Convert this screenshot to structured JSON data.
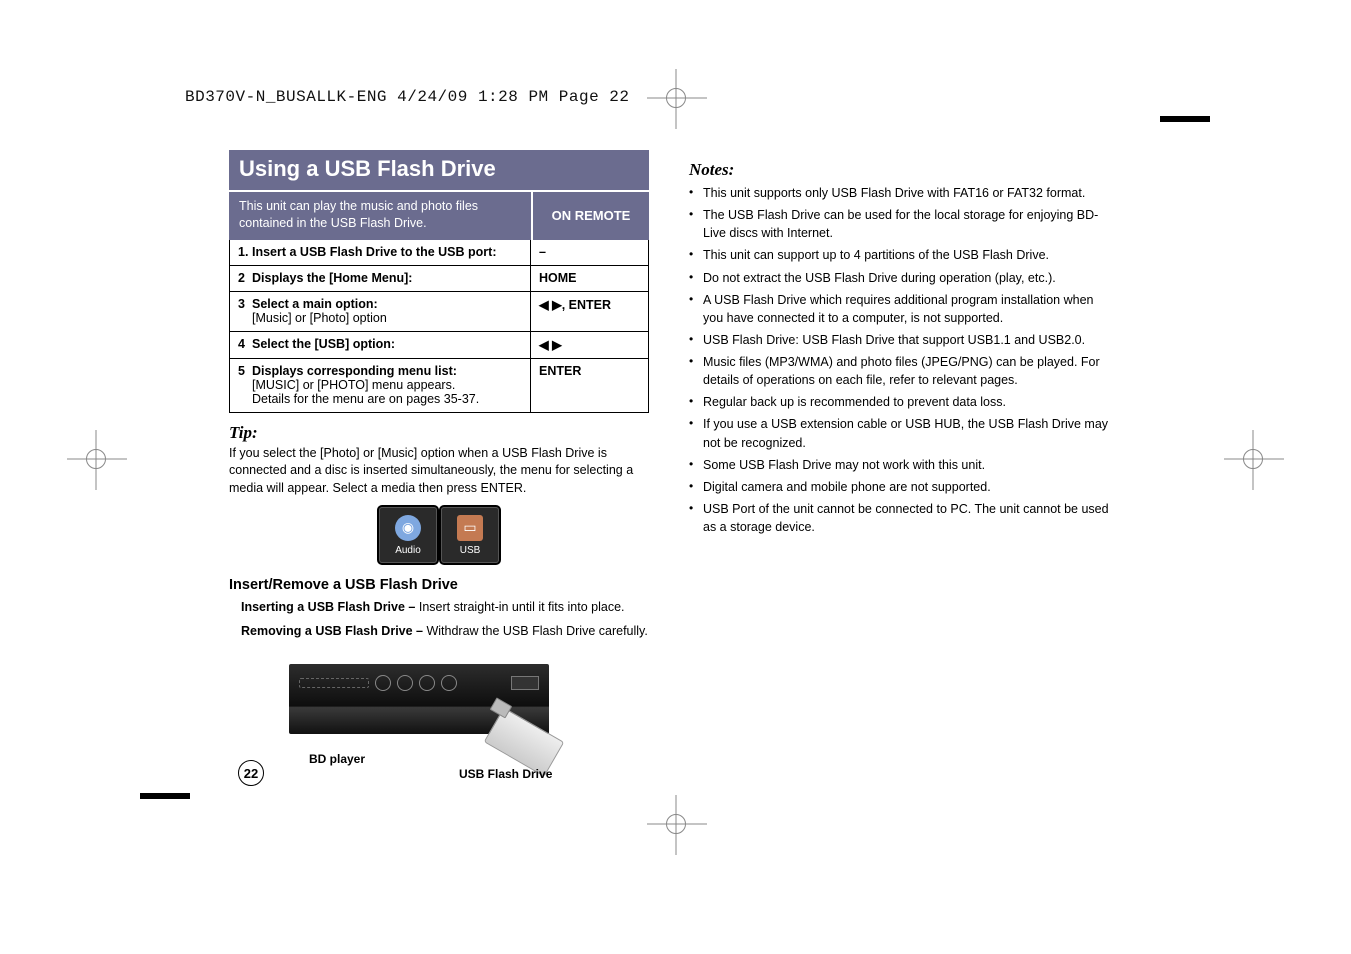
{
  "header": "BD370V-N_BUSALLK-ENG  4/24/09  1:28 PM  Page 22",
  "page_number": "22",
  "title": "Using a USB Flash Drive",
  "title_desc": "This unit can play the music and photo files contained in the USB Flash Drive.",
  "on_remote": "ON REMOTE",
  "steps": [
    {
      "num": "1.",
      "label": "Insert a USB Flash Drive to the USB port:",
      "sub": "",
      "ctrl": "–"
    },
    {
      "num": "2",
      "label": "Displays the [Home Menu]:",
      "sub": "",
      "ctrl": "HOME"
    },
    {
      "num": "3",
      "label": "Select a main option:",
      "sub": "[Music] or [Photo] option",
      "ctrl": "◀ ▶, ENTER"
    },
    {
      "num": "4",
      "label": "Select the [USB] option:",
      "sub": "",
      "ctrl": "◀ ▶"
    },
    {
      "num": "5",
      "label": "Displays corresponding menu list:",
      "sub": "[MUSIC] or [PHOTO] menu appears.\nDetails for the menu are on pages 35-37.",
      "ctrl": "ENTER"
    }
  ],
  "tip_heading": "Tip:",
  "tip_body": "If you select the [Photo] or [Music] option when a USB Flash Drive is connected and a disc is inserted simultaneously, the menu for selecting a media will appear. Select a media then press ENTER.",
  "tiles": {
    "audio": "Audio",
    "usb": "USB"
  },
  "subheading": "Insert/Remove a USB Flash Drive",
  "insert_bold": "Inserting a USB Flash Drive – ",
  "insert_rest": "Insert straight-in until it fits into place.",
  "remove_bold": "Removing a USB Flash Drive – ",
  "remove_rest": "Withdraw the USB Flash Drive carefully.",
  "player_label": "BD player",
  "usb_label": "USB Flash Drive",
  "notes_heading": "Notes:",
  "notes": [
    "This unit supports only USB Flash Drive with FAT16 or FAT32 format.",
    "The USB Flash Drive can be used for the local storage for enjoying BD-Live discs with Internet.",
    "This unit can support up to 4 partitions of the USB Flash Drive.",
    "Do not extract the USB Flash Drive during operation (play, etc.).",
    "A USB Flash Drive which requires additional program installation when you have connected it to a computer, is not supported.",
    "USB Flash Drive: USB Flash Drive that support USB1.1 and USB2.0.",
    "Music files (MP3/WMA) and photo files (JPEG/PNG) can be played. For details of operations on each file, refer to relevant pages.",
    "Regular back up is recommended to prevent data loss.",
    "If you use a USB extension cable or USB HUB, the USB Flash Drive may not be recognized.",
    "Some USB Flash Drive may not work with this unit.",
    "Digital camera and mobile phone are not supported.",
    "USB Port of the unit cannot be connected to PC. The unit cannot be used as a storage device."
  ]
}
